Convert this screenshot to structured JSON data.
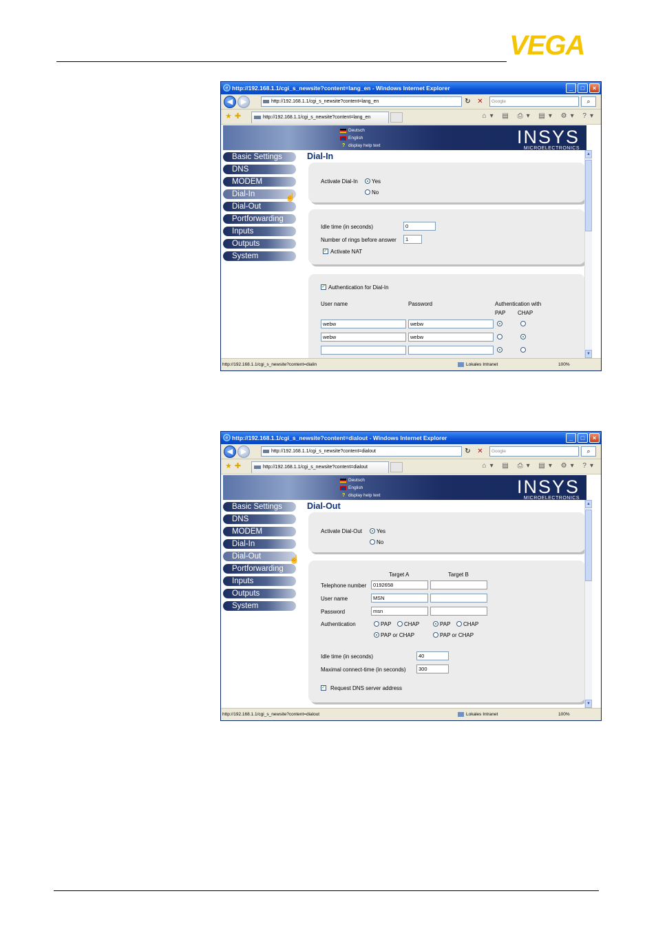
{
  "brand": {
    "logo_text": "VEGA",
    "logo_color": "#f5c400"
  },
  "windows": [
    {
      "title": "http://192.168.1.1/cgi_s_newsite?content=lang_en - Windows Internet Explorer",
      "address": "http://192.168.1.1/cgi_s_newsite?content=lang_en",
      "tab": "http://192.168.1.1/cgi_s_newsite?content=lang_en",
      "search_placeholder": "Google",
      "status_url": "http://192.168.1.1/cgi_s_newsite?content=dialin",
      "status_zone": "Lokales Intranet",
      "status_zoom": "100%",
      "page_title": "Dial-In",
      "activate": {
        "label": "Activate Dial-In",
        "yes": "Yes",
        "no": "No",
        "selected": "Yes"
      },
      "settings": {
        "idle_label": "Idle time (in seconds)",
        "idle_value": "0",
        "rings_label": "Number of rings before answer",
        "rings_value": "1",
        "nat_label": "Activate NAT",
        "nat_checked": true
      },
      "auth": {
        "title": "Authentication for Dial-In",
        "col_user": "User name",
        "col_pass": "Password",
        "col_auth": "Authentication with",
        "col_pap": "PAP",
        "col_chap": "CHAP",
        "rows": [
          {
            "user": "webw",
            "pass": "webw",
            "auth": "PAP"
          },
          {
            "user": "webw",
            "pass": "webw",
            "auth": "CHAP"
          },
          {
            "user": "",
            "pass": "",
            "auth": "PAP"
          }
        ]
      }
    },
    {
      "title": "http://192.168.1.1/cgi_s_newsite?content=dialout - Windows Internet Explorer",
      "address": "http://192.168.1.1/cgi_s_newsite?content=dialout",
      "tab": "http://192.168.1.1/cgi_s_newsite?content=dialout",
      "search_placeholder": "Google",
      "status_url": "http://192.168.1.1/cgi_s_newsite?content=dialout",
      "status_zone": "Lokales Intranet",
      "status_zoom": "100%",
      "page_title": "Dial-Out",
      "activate": {
        "label": "Activate Dial-Out",
        "yes": "Yes",
        "no": "No",
        "selected": "Yes"
      },
      "targets": {
        "col_a": "Target A",
        "col_b": "Target B",
        "phone_label": "Telephone number",
        "phone_a": "0192658",
        "phone_b": "",
        "user_label": "User name",
        "user_a": "MSN",
        "user_b": "",
        "pass_label": "Password",
        "pass_a": "msn",
        "pass_b": "",
        "auth_label": "Authentication",
        "opt_pap": "PAP",
        "opt_chap": "CHAP",
        "opt_either": "PAP or CHAP",
        "auth_a": "PAP or CHAP",
        "auth_b": "PAP"
      },
      "timing": {
        "idle_label": "Idle time (in seconds)",
        "idle_value": "40",
        "max_label": "Maximal connect-time (in seconds)",
        "max_value": "300",
        "dns_label": "Request DNS server address",
        "dns_checked": true
      }
    }
  ],
  "banner": {
    "deutsch": "Deutsch",
    "english": "English",
    "help": "display help text",
    "insys": "INSYS",
    "insys_sub": "MICROELECTRONICS"
  },
  "nav": [
    "Basic Settings",
    "DNS",
    "MODEM",
    "Dial-In",
    "Dial-Out",
    "Portforwarding",
    "Inputs",
    "Outputs",
    "System"
  ]
}
